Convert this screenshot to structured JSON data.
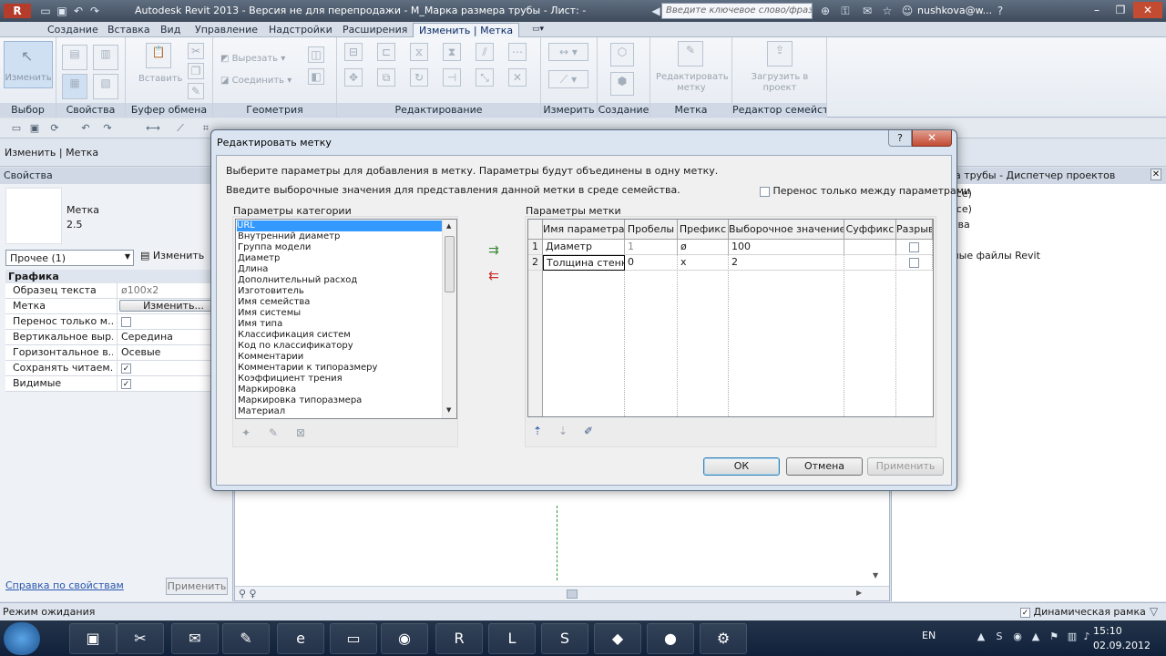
{
  "window": {
    "title": "Autodesk Revit 2013 - Версия не для перепродажи -   М_Марка размера трубы - Лист: -",
    "search_placeholder": "Введите ключевое слово/фразу",
    "user": "nushkova@w..."
  },
  "ribbon": {
    "tabs": [
      "Создание",
      "Вставка",
      "Вид",
      "Управление",
      "Надстройки",
      "Расширения",
      "Изменить | Метка"
    ],
    "active_tab": "Изменить | Метка",
    "modify_label": "Изменить",
    "paste_label": "Вставить",
    "cut_label": "Вырезать",
    "join_label": "Соединить",
    "edit_label_btn": "Редактировать метку",
    "load_into_project": "Загрузить в проект",
    "panels": [
      "Выбор",
      "Свойства",
      "Буфер обмена",
      "Геометрия",
      "Редактирование",
      "Измерить",
      "Создание",
      "Метка",
      "Редактор семейств"
    ]
  },
  "context_bar": {
    "label": "Изменить | Метка"
  },
  "properties": {
    "header": "Свойства",
    "type_name": "Метка",
    "type_size": "2.5",
    "filter": "Прочее (1)",
    "edit_type": "Изменить",
    "group": "Графика",
    "rows": [
      {
        "name": "Образец текста",
        "value": "ø100x2"
      },
      {
        "name": "Метка",
        "value": "Изменить..."
      },
      {
        "name": "Перенос только м...",
        "value": ""
      },
      {
        "name": "Вертикальное выр...",
        "value": "Середина"
      },
      {
        "name": "Горизонтальное в...",
        "value": "Осевые"
      },
      {
        "name": "Сохранять читаем...",
        "value": ""
      },
      {
        "name": "Видимые",
        "value": ""
      }
    ],
    "help_link": "Справка по свойствам",
    "apply": "Применить"
  },
  "browser": {
    "header": "ра трубы - Диспетчер проектов",
    "items": [
      "(все)",
      "(все)",
      "ства",
      "ы",
      "ьные файлы Revit"
    ]
  },
  "status": {
    "text": "Режим ожидания",
    "dynamic_frame": "Динамическая рамка"
  },
  "dialog": {
    "title": "Редактировать метку",
    "help": "?",
    "close": "✕",
    "desc1": "Выберите параметры для добавления в метку.  Параметры будут объединены в одну метку.",
    "desc2": "Введите выборочные значения для представления данной метки в среде семейства.",
    "wrap_checkbox": "Перенос только между параметрами",
    "category_params_label": "Параметры категории",
    "category_params": [
      "URL",
      "Внутренний диаметр",
      "Группа модели",
      "Диаметр",
      "Длина",
      "Дополнительный расход",
      "Изготовитель",
      "Имя семейства",
      "Имя системы",
      "Имя типа",
      "Классификация систем",
      "Код по классификатору",
      "Комментарии",
      "Комментарии к типоразмеру",
      "Коэффициент трения",
      "Маркировка",
      "Маркировка типоразмера",
      "Материал"
    ],
    "label_params_label": "Параметры метки",
    "columns": [
      "Имя параметра",
      "Пробелы",
      "Префикс",
      "Выборочное значение",
      "Суффикс",
      "Разрыв"
    ],
    "rows": [
      {
        "n": "1",
        "name": "Диаметр",
        "spaces": "1",
        "prefix": "ø",
        "sample": "100",
        "suffix": ""
      },
      {
        "n": "2",
        "name": "Толщина стенк",
        "spaces": "0",
        "prefix": "x",
        "sample": "2",
        "suffix": ""
      }
    ],
    "ok": "ОК",
    "cancel": "Отмена",
    "apply": "Применить"
  },
  "taskbar": {
    "lang": "EN",
    "time": "15:10",
    "date": "02.09.2012"
  }
}
